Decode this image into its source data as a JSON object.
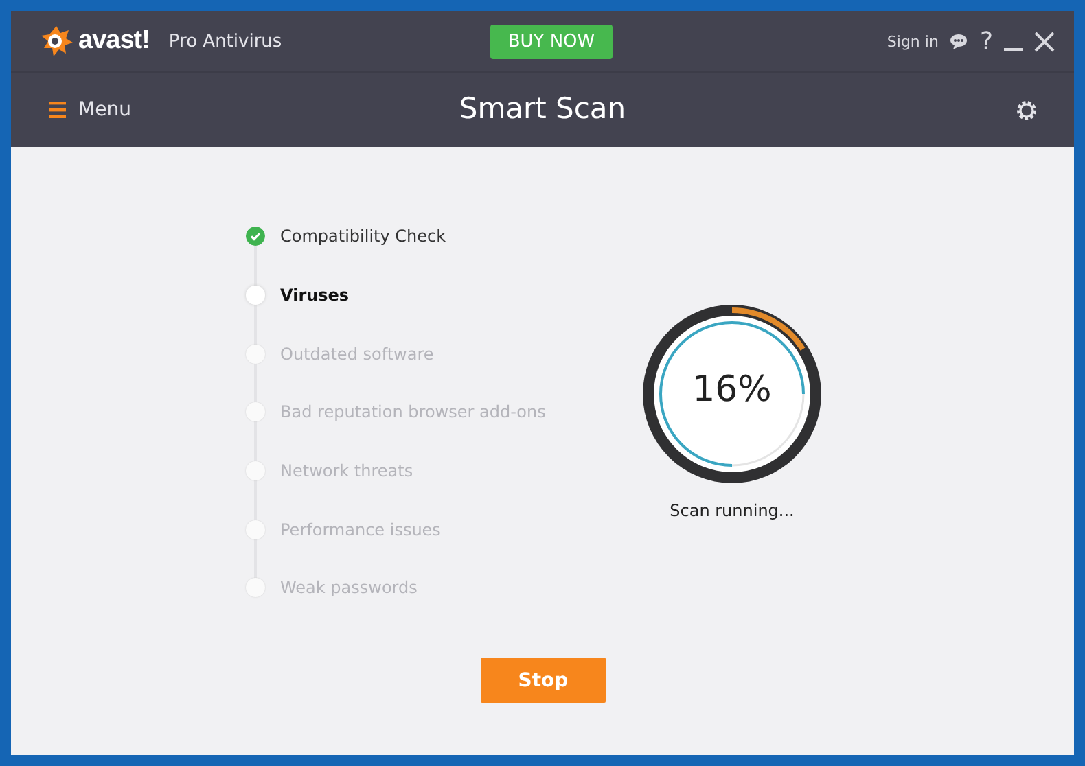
{
  "header": {
    "brand": "avast!",
    "product": "Pro Antivirus",
    "buy_button": "BUY NOW",
    "sign_in": "Sign in",
    "help": "?"
  },
  "toolbar": {
    "menu": "Menu",
    "title": "Smart Scan"
  },
  "steps": [
    {
      "label": "Compatibility Check",
      "completed": true,
      "current": false
    },
    {
      "label": "Viruses",
      "completed": false,
      "current": true
    },
    {
      "label": "Outdated software",
      "completed": false,
      "current": false
    },
    {
      "label": "Bad reputation browser add-ons",
      "completed": false,
      "current": false
    },
    {
      "label": "Network threats",
      "completed": false,
      "current": false
    },
    {
      "label": "Performance issues",
      "completed": false,
      "current": false
    },
    {
      "label": "Weak passwords",
      "completed": false,
      "current": false
    }
  ],
  "progress": {
    "level": 0.16,
    "reading": "16%",
    "status": "Scan running..."
  },
  "stop_button": "Stop"
}
